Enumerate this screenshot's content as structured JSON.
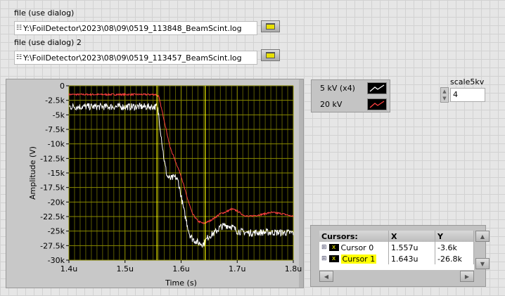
{
  "file1": {
    "label": "file (use dialog)",
    "value": "Y:\\FoilDetector\\2023\\08\\09\\0519_113848_BeamScint.log"
  },
  "file2": {
    "label": "file (use dialog) 2",
    "value": "Y:\\FoilDetector\\2023\\08\\09\\0519_113457_BeamScint.log"
  },
  "legend": [
    {
      "label": "5 kV (x4)",
      "color": "#ffffff"
    },
    {
      "label": "20 kV",
      "color": "#ff4040"
    }
  ],
  "scale": {
    "label": "scale5kv",
    "value": "4"
  },
  "cursors": {
    "headers": [
      "Cursors:",
      "X",
      "Y"
    ],
    "rows": [
      {
        "name": "Cursor 0",
        "x": "1.557u",
        "y": "-3.6k"
      },
      {
        "name": "Cursor 1",
        "x": "1.643u",
        "y": "-26.8k"
      }
    ]
  },
  "chart_data": {
    "type": "line",
    "xlabel": "Time (s)",
    "ylabel": "Amplitude (V)",
    "xlim": [
      1.4,
      1.8
    ],
    "ylim": [
      -30000,
      0
    ],
    "xticks": [
      "1.4u",
      "1.5u",
      "1.6u",
      "1.7u",
      "1.8u"
    ],
    "yticks": [
      "0",
      "-2.5k",
      "-5k",
      "-7.5k",
      "-10k",
      "-12.5k",
      "-15k",
      "-17.5k",
      "-20k",
      "-22.5k",
      "-25k",
      "-27.5k",
      "-30k"
    ],
    "cursors_x": [
      1.557,
      1.643
    ],
    "series": [
      {
        "name": "20 kV",
        "color": "#ff4040",
        "noise": 300,
        "x": [
          1.4,
          1.555,
          1.56,
          1.57,
          1.58,
          1.59,
          1.6,
          1.61,
          1.62,
          1.63,
          1.64,
          1.65,
          1.66,
          1.67,
          1.68,
          1.69,
          1.7,
          1.71,
          1.72,
          1.74,
          1.76,
          1.78,
          1.8
        ],
        "y": [
          -1500,
          -1500,
          -1800,
          -6000,
          -10500,
          -13000,
          -15500,
          -19000,
          -22000,
          -23300,
          -23700,
          -23300,
          -22700,
          -22000,
          -21700,
          -21200,
          -21500,
          -22200,
          -22500,
          -22200,
          -21800,
          -22000,
          -22500
        ]
      },
      {
        "name": "5 kV (x4)",
        "color": "#ffffff",
        "noise": 1200,
        "x": [
          1.4,
          1.557,
          1.56,
          1.565,
          1.57,
          1.575,
          1.58,
          1.59,
          1.595,
          1.6,
          1.605,
          1.61,
          1.615,
          1.62,
          1.63,
          1.64,
          1.645,
          1.65,
          1.66,
          1.67,
          1.68,
          1.69,
          1.7,
          1.72,
          1.75,
          1.8
        ],
        "y": [
          -3600,
          -3600,
          -5000,
          -9000,
          -13000,
          -15500,
          -16000,
          -15700,
          -16500,
          -19000,
          -21500,
          -23500,
          -25500,
          -26300,
          -27000,
          -27200,
          -26500,
          -25800,
          -25300,
          -24300,
          -24000,
          -24200,
          -25000,
          -25300,
          -25200,
          -25300
        ]
      }
    ]
  }
}
